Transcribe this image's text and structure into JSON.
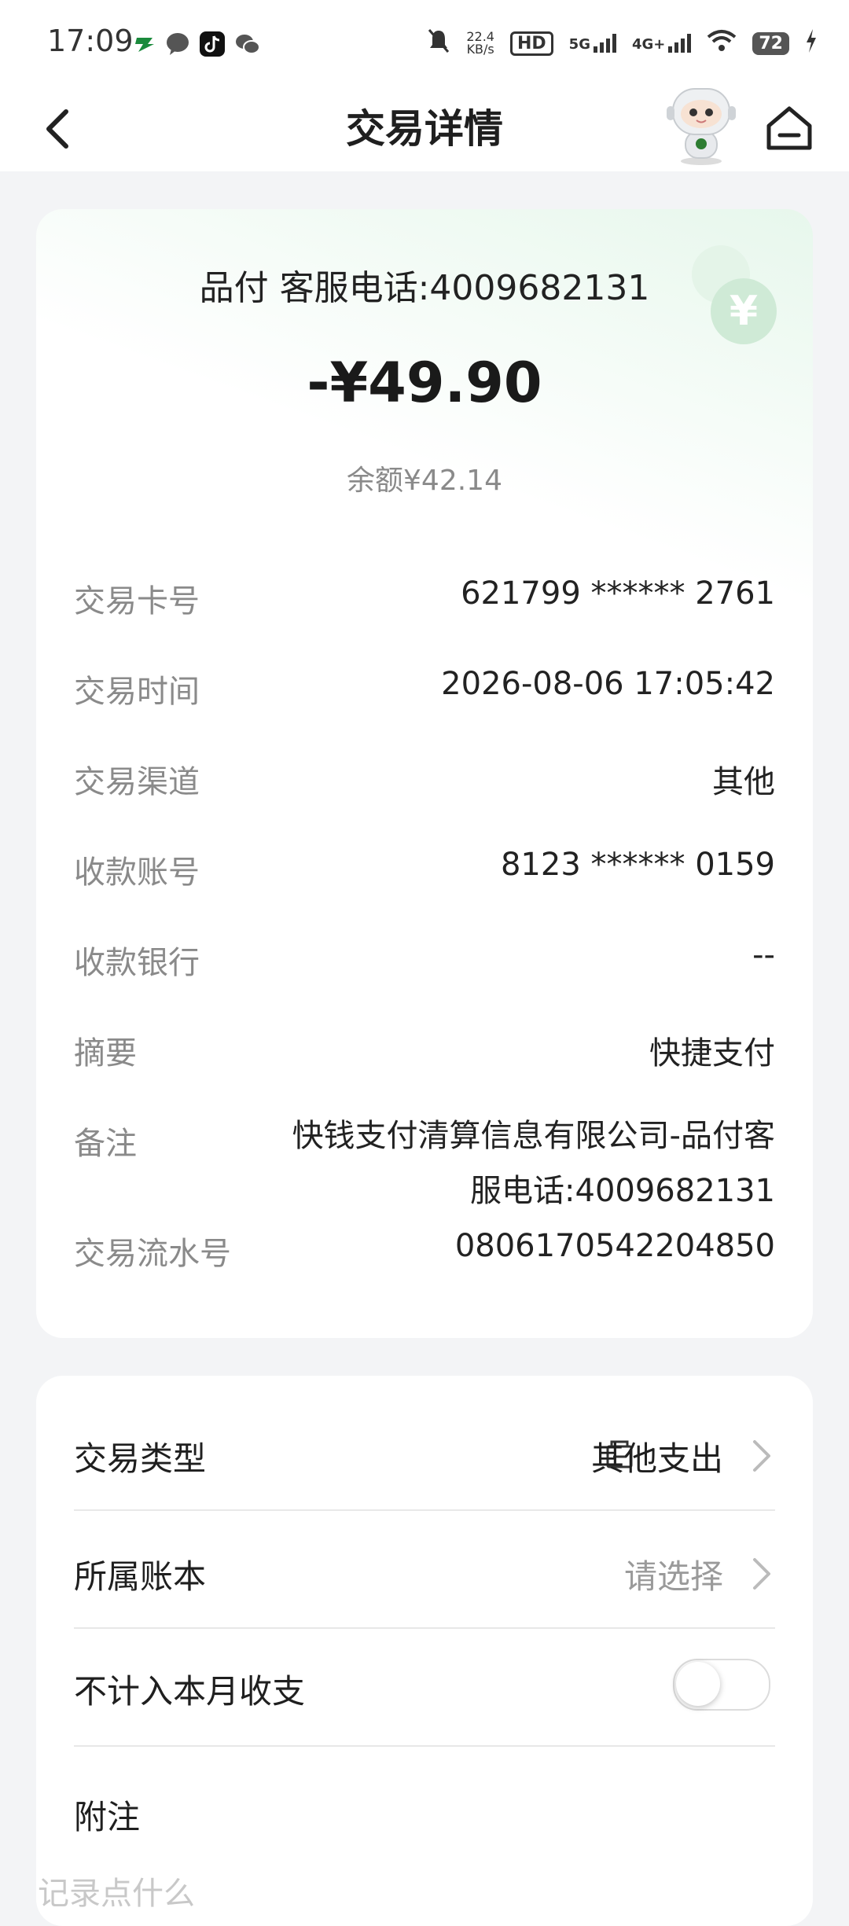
{
  "status_bar": {
    "time": "17:09",
    "net_speed_value": "22.4",
    "net_speed_unit": "KB/s",
    "hd_label": "HD",
    "signal_5g": "5G",
    "signal_4g": "4G+",
    "battery": "72",
    "icons": [
      "post-app-icon",
      "message-icon",
      "tiktok-icon",
      "wechat-icon",
      "mute-icon",
      "wifi-icon",
      "charging-icon"
    ]
  },
  "nav": {
    "title": "交易详情",
    "icons": [
      "back-icon",
      "mascot-avatar",
      "home-icon"
    ]
  },
  "transaction": {
    "merchant": "品付 客服电话:4009682131",
    "amount": "-¥49.90",
    "balance": "余额¥42.14",
    "coin_symbol": "¥",
    "fields": [
      {
        "label": "交易卡号",
        "value": "621799 ****** 2761"
      },
      {
        "label": "交易时间",
        "value": "2026-08-06 17:05:42"
      },
      {
        "label": "交易渠道",
        "value": "其他"
      },
      {
        "label": "收款账号",
        "value": "8123 ****** 0159"
      },
      {
        "label": "收款银行",
        "value": "--"
      },
      {
        "label": "摘要",
        "value": "快捷支付"
      },
      {
        "label": "备注",
        "value": "快钱支付清算信息有限公司-品付客服电话:4009682131"
      },
      {
        "label": "交易流水号",
        "value": "0806170542204850"
      }
    ]
  },
  "settings": {
    "type_label": "交易类型",
    "type_value": "其他支出",
    "ledger_label": "所属账本",
    "ledger_placeholder": "请选择",
    "exclude_label": "不计入本月收支",
    "exclude_enabled": false,
    "note_label": "附注",
    "note_hint": "记录点什么"
  },
  "colors": {
    "accent_green": "#cfead6",
    "page_bg": "#f3f4f6"
  }
}
